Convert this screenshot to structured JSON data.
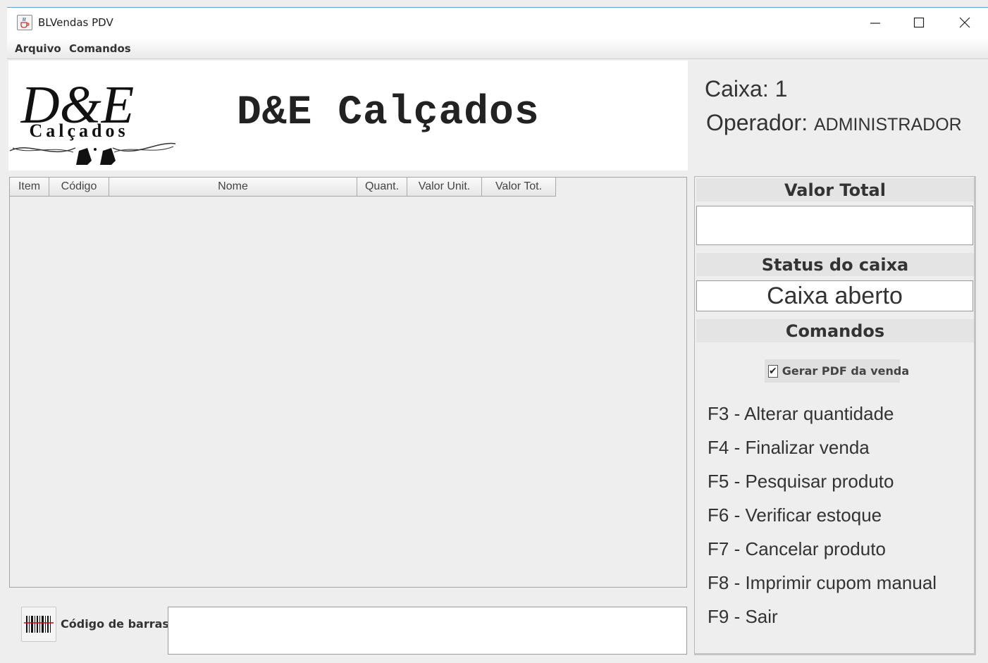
{
  "window": {
    "title": "BLVendas PDV",
    "controls": {
      "minimize": "—",
      "maximize": "☐",
      "close": "✕"
    }
  },
  "menu": {
    "items": [
      "Arquivo",
      "Comandos"
    ]
  },
  "header": {
    "logo": {
      "top": "D&E",
      "bottom": "Calçados"
    },
    "title": "D&E Calçados",
    "caixa_label": "Caixa:",
    "caixa_value": "1",
    "operador_label": "Operador:",
    "operador_value": "ADMINISTRADOR"
  },
  "table": {
    "columns": [
      "Item",
      "Código",
      "Nome",
      "Quant.",
      "Valor Unit.",
      "Valor Tot."
    ],
    "rows": []
  },
  "barcode": {
    "label": "Código de barras",
    "value": ""
  },
  "right_panel": {
    "valor_total_label": "Valor Total",
    "valor_total_value": "",
    "status_label": "Status do caixa",
    "status_value": "Caixa aberto",
    "comandos_label": "Comandos",
    "gerar_pdf_label": "Gerar PDF da venda",
    "gerar_pdf_checked": true,
    "commands": [
      "F3 - Alterar quantidade",
      "F4 - Finalizar venda",
      "F5 - Pesquisar produto",
      "F6 - Verificar estoque",
      "F7 - Cancelar produto",
      "F8 - Imprimir cupom manual",
      "F9 - Sair"
    ]
  },
  "icons": {
    "app": "java-cup-icon",
    "logo": "shoe-logo-icon",
    "barcode": "barcode-icon"
  }
}
